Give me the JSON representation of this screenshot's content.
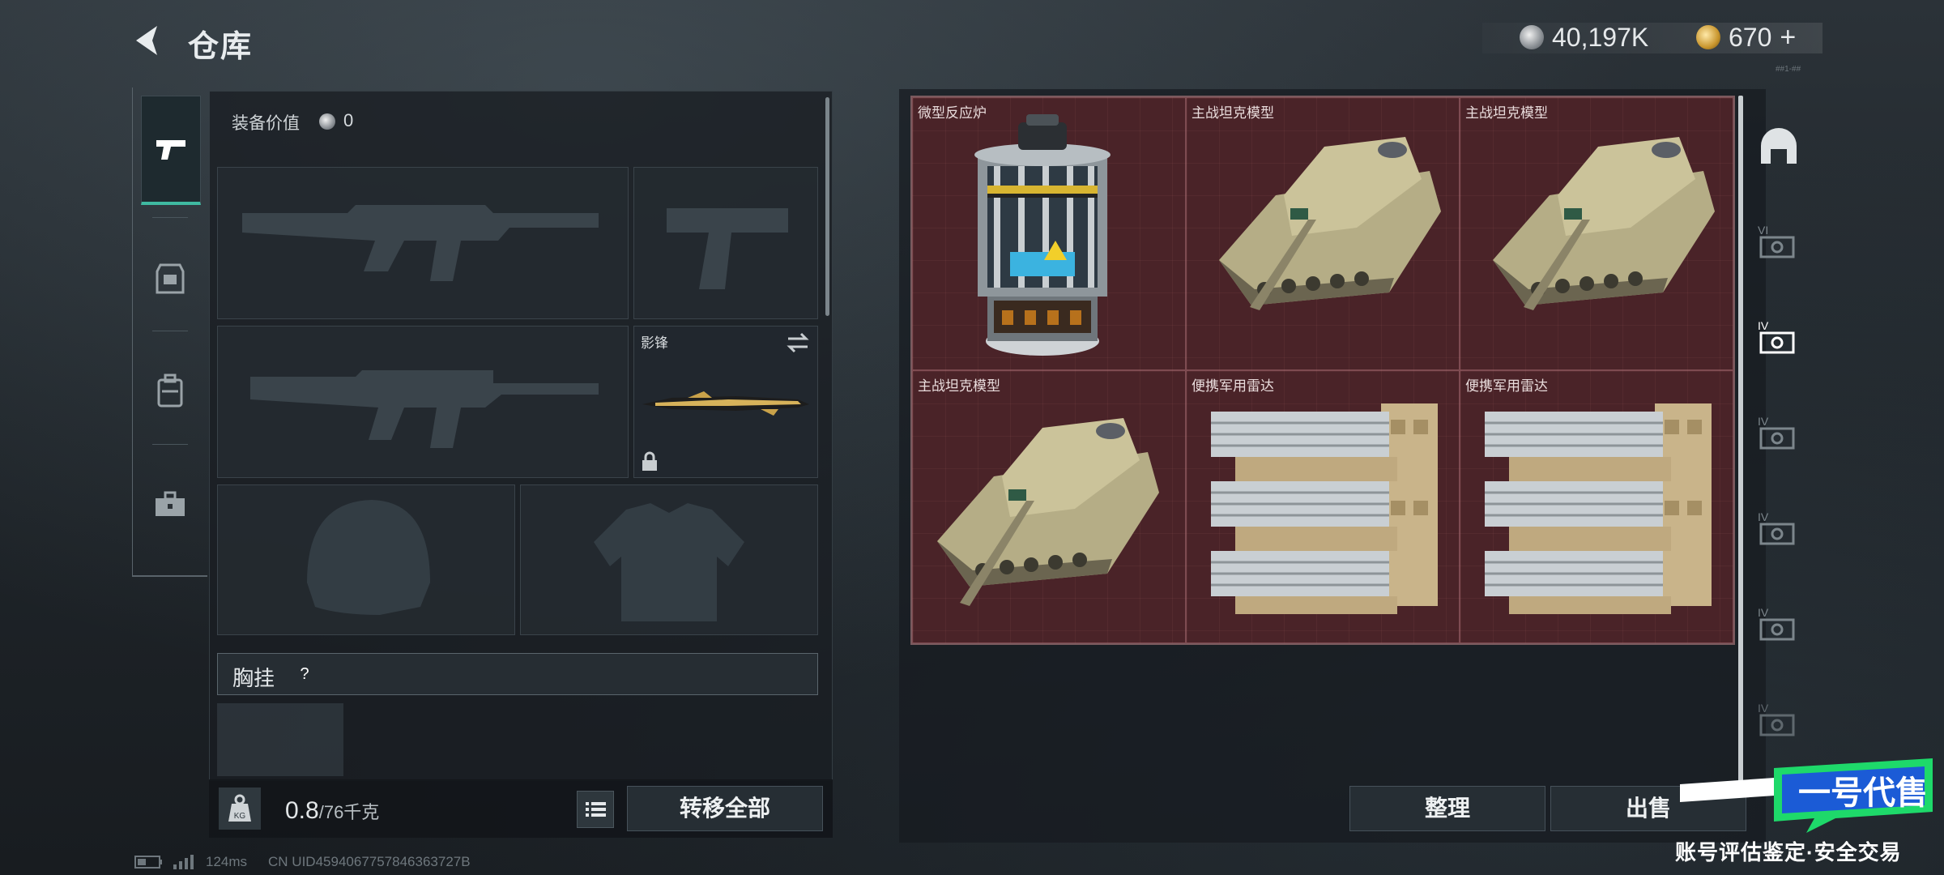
{
  "header": {
    "title": "仓库",
    "silver_amount": "40,197K",
    "gold_amount": "670",
    "gold_plus": "+",
    "tiny_code": "##1-##"
  },
  "left_tabs": [
    "pistol-icon",
    "armor-icon",
    "backpack-icon",
    "toolbox-icon"
  ],
  "loadout": {
    "equip_value_label": "装备价值",
    "equip_value": "0",
    "melee_slot_name": "影锋",
    "chest_label": "胸挂",
    "chest_help": "?"
  },
  "footer_left": {
    "weight_value": "0.8",
    "weight_max": "/76千克",
    "transfer_label": "转移全部"
  },
  "storage": {
    "items": [
      {
        "name": "微型反应炉",
        "icon": "reactor"
      },
      {
        "name": "主战坦克模型",
        "icon": "tank"
      },
      {
        "name": "主战坦克模型",
        "icon": "tank"
      },
      {
        "name": "主战坦克模型",
        "icon": "tank"
      },
      {
        "name": "便携军用雷达",
        "icon": "radar"
      },
      {
        "name": "便携军用雷达",
        "icon": "radar"
      }
    ],
    "rail": [
      "VI",
      "IV",
      "IV",
      "IV",
      "IV",
      "IV"
    ],
    "sort_label": "整理",
    "sell_label": "出售"
  },
  "watermark": {
    "brand": "一号代售",
    "subtitle": "账号评估鉴定·安全交易"
  },
  "status": {
    "ping": "124ms",
    "uid": "CN UID4594067757846363727B"
  },
  "colors": {
    "accent": "#3fb9a1",
    "item_bg": "#4a2328",
    "watermark_green": "#1ed96a",
    "watermark_blue": "#1b5bd6"
  }
}
